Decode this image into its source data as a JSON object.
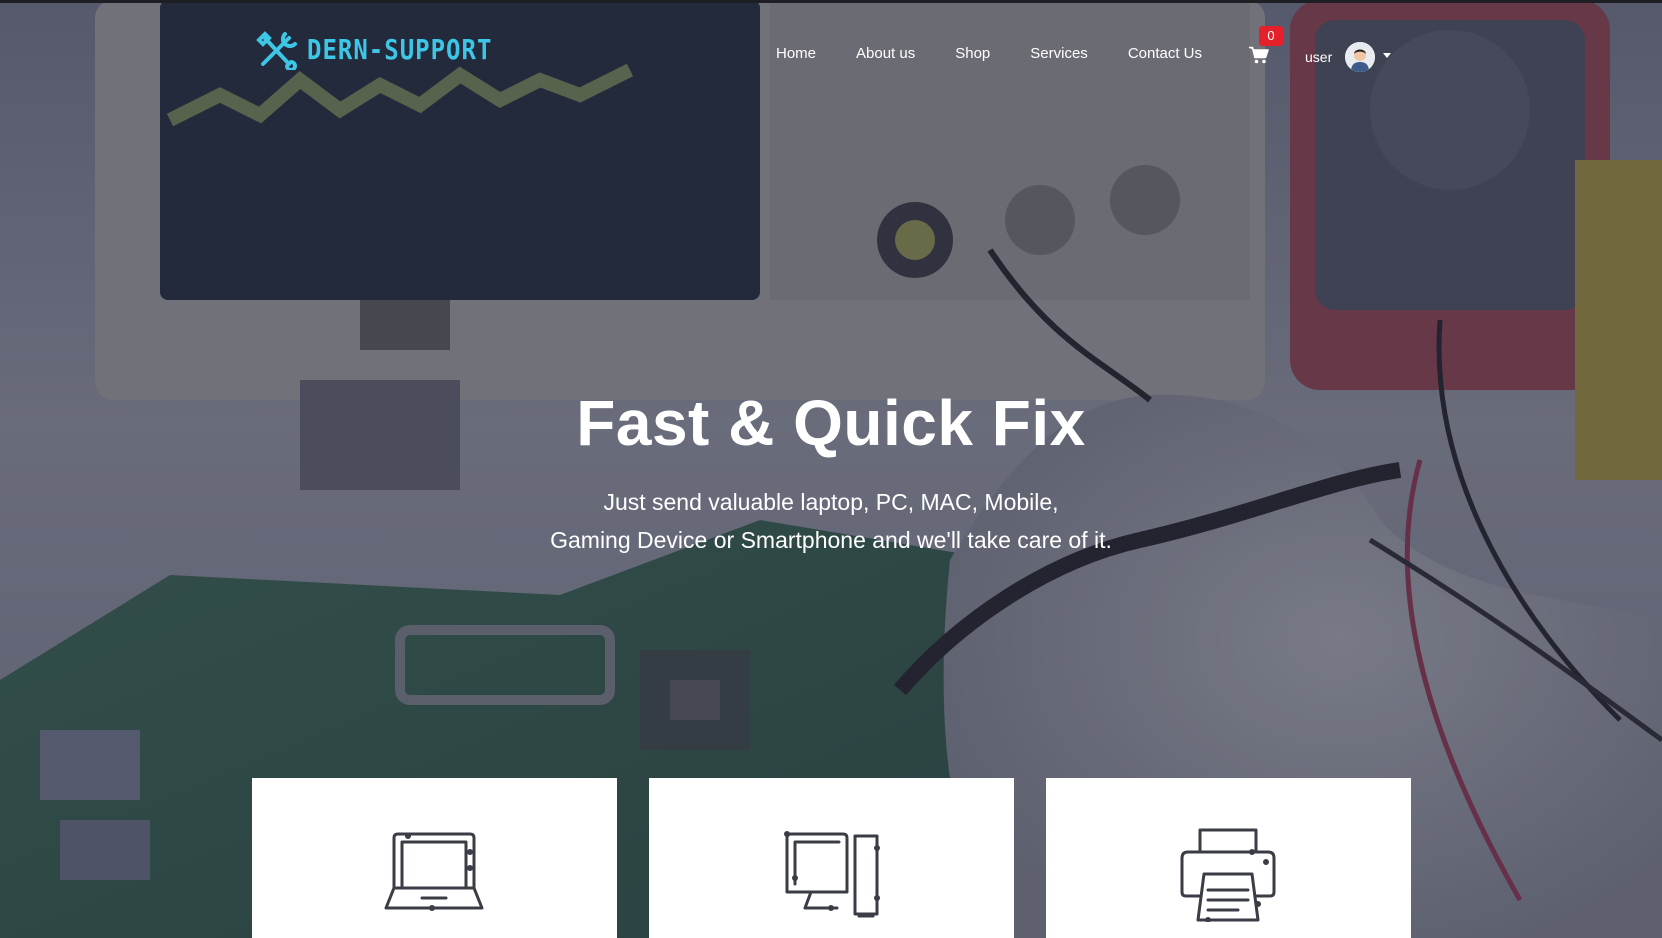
{
  "brand": {
    "name": "DERN-SUPPORT",
    "icon": "wrench-screwdriver-icon",
    "color": "#3ec6e6"
  },
  "nav": {
    "links": [
      "Home",
      "About us",
      "Shop",
      "Services",
      "Contact Us"
    ]
  },
  "cart": {
    "icon": "cart-icon",
    "count": "0",
    "badge_color": "#e5202b"
  },
  "user": {
    "label": "user",
    "avatar": "user-avatar"
  },
  "hero": {
    "title": "Fast & Quick Fix",
    "subtitle_line1": "Just send valuable laptop, PC, MAC, Mobile,",
    "subtitle_line2": "Gaming Device or Smartphone and we'll take care of it."
  },
  "cards": [
    {
      "icon": "laptop-icon"
    },
    {
      "icon": "desktop-tablet-icon"
    },
    {
      "icon": "printer-icon"
    }
  ]
}
